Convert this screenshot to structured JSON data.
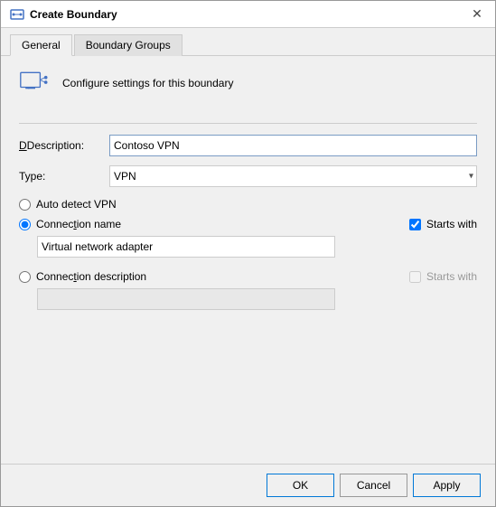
{
  "window": {
    "title": "Create Boundary",
    "close_label": "✕"
  },
  "tabs": [
    {
      "id": "general",
      "label": "General",
      "active": true
    },
    {
      "id": "boundary-groups",
      "label": "Boundary Groups",
      "active": false
    }
  ],
  "header": {
    "description": "Configure settings for this boundary"
  },
  "form": {
    "description_label": "Description:",
    "description_value": "Contoso VPN",
    "type_label": "Type:",
    "type_value": "VPN",
    "type_options": [
      "VPN"
    ]
  },
  "vpn_options": {
    "auto_detect_label": "Auto detect VPN",
    "connection_name_label": "Connection name",
    "starts_with_label": "Starts with",
    "connection_name_value": "Virtual network adapter",
    "connection_desc_label": "Connection description",
    "connection_desc_starts_with": "Starts with",
    "connection_desc_value": ""
  },
  "footer": {
    "ok_label": "OK",
    "cancel_label": "Cancel",
    "apply_label": "Apply"
  }
}
